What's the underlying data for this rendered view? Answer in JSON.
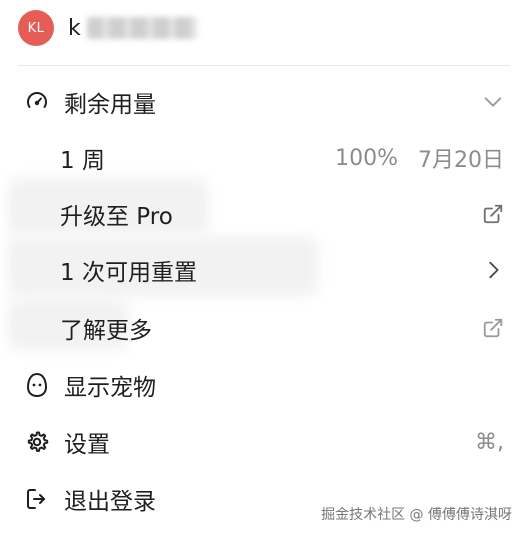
{
  "user": {
    "initials": "KL",
    "name_visible": "k"
  },
  "menu": {
    "usage": {
      "label": "剩余用量",
      "icon": "gauge-icon",
      "trail_icon": "chevron-down-icon"
    },
    "week": {
      "label": "1 周",
      "percent": "100%",
      "reset_date": "7月20日"
    },
    "upgrade": {
      "label": "升级至 Pro",
      "trail_icon": "external-link-icon"
    },
    "resets": {
      "label": "1 次可用重置",
      "trail_icon": "chevron-right-icon"
    },
    "learn_more": {
      "label": "了解更多",
      "trail_icon": "external-link-icon"
    },
    "show_pet": {
      "label": "显示宠物",
      "icon": "pet-egg-icon"
    },
    "settings": {
      "label": "设置",
      "icon": "gear-icon",
      "shortcut": "⌘,"
    },
    "logout": {
      "label": "退出登录",
      "icon": "logout-icon"
    }
  },
  "watermark": "掘金技术社区 @ 傅傅傅诗淇呀",
  "colors": {
    "avatar": "#e45d57",
    "text": "#1f1f1f",
    "muted": "#8c8c8c",
    "divider": "#e6e6e6"
  }
}
